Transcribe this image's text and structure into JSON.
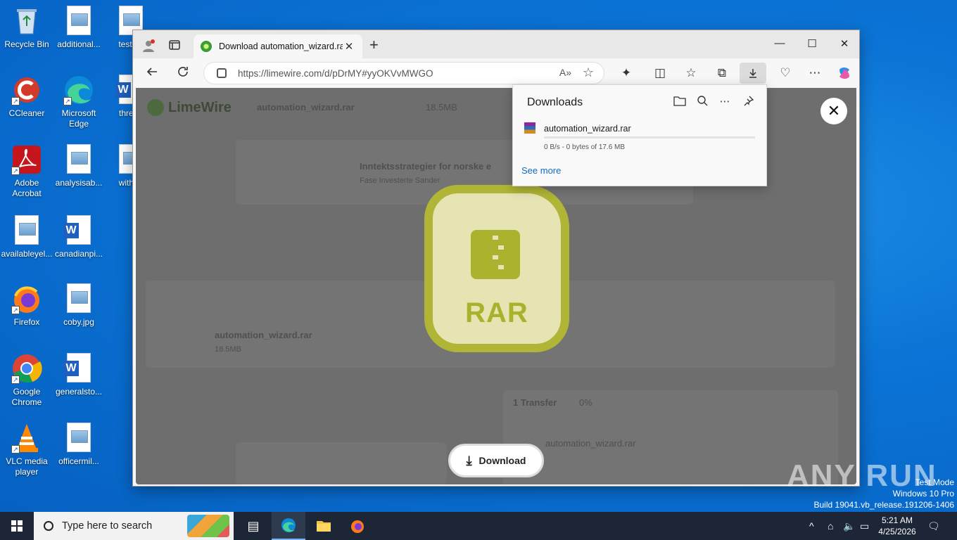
{
  "desktop": {
    "icons": [
      {
        "label": "Recycle Bin"
      },
      {
        "label": "additional..."
      },
      {
        "label": "testing"
      },
      {
        "label": "CCleaner"
      },
      {
        "label": "Microsoft Edge"
      },
      {
        "label": "thread"
      },
      {
        "label": "Adobe Acrobat"
      },
      {
        "label": "analysisab..."
      },
      {
        "label": "withou"
      },
      {
        "label": "availableyel..."
      },
      {
        "label": "canadianpi..."
      },
      {
        "label": "Firefox"
      },
      {
        "label": "coby.jpg"
      },
      {
        "label": "Google Chrome"
      },
      {
        "label": "generalsto..."
      },
      {
        "label": "VLC media player"
      },
      {
        "label": "officermil..."
      }
    ]
  },
  "browser": {
    "tab_title": "Download automation_wizard.rar",
    "url": "https://limewire.com/d/pDrMY#yyOKVvMWGO",
    "new_tab_symbol": "+",
    "tab_close": "✕",
    "window": {
      "minimize": "—",
      "maximize": "☐",
      "close": "✕"
    }
  },
  "page": {
    "logo": "LimeWire",
    "file_header": "automation_wizard.rar",
    "file_size": "18.5MB",
    "ad_title": "Inntektsstrategier for norske e",
    "ad_sub": "Fase Investerte Sander",
    "file_row_name": "automation_wizard.rar",
    "file_row_size": "18.5MB",
    "transfer_label": "1 Transfer",
    "transfer_pct": "0%",
    "transfer_file": "automation_wizard.rar",
    "rar_label": "RAR",
    "download_button": "Download",
    "close_symbol": "✕"
  },
  "downloads_flyout": {
    "title": "Downloads",
    "file_name": "automation_wizard.rar",
    "status": "0 B/s - 0 bytes of 17.6 MB",
    "progress_percent": 0,
    "see_more": "See more"
  },
  "watermark": {
    "brand": "ANY RUN",
    "line1": "Test Mode",
    "line2": "Windows 10 Pro",
    "line3": "Build 19041.vb_release.191206-1406"
  },
  "taskbar": {
    "search_placeholder": "Type here to search",
    "time": "5:21 AM",
    "date": "4/25/2026"
  }
}
